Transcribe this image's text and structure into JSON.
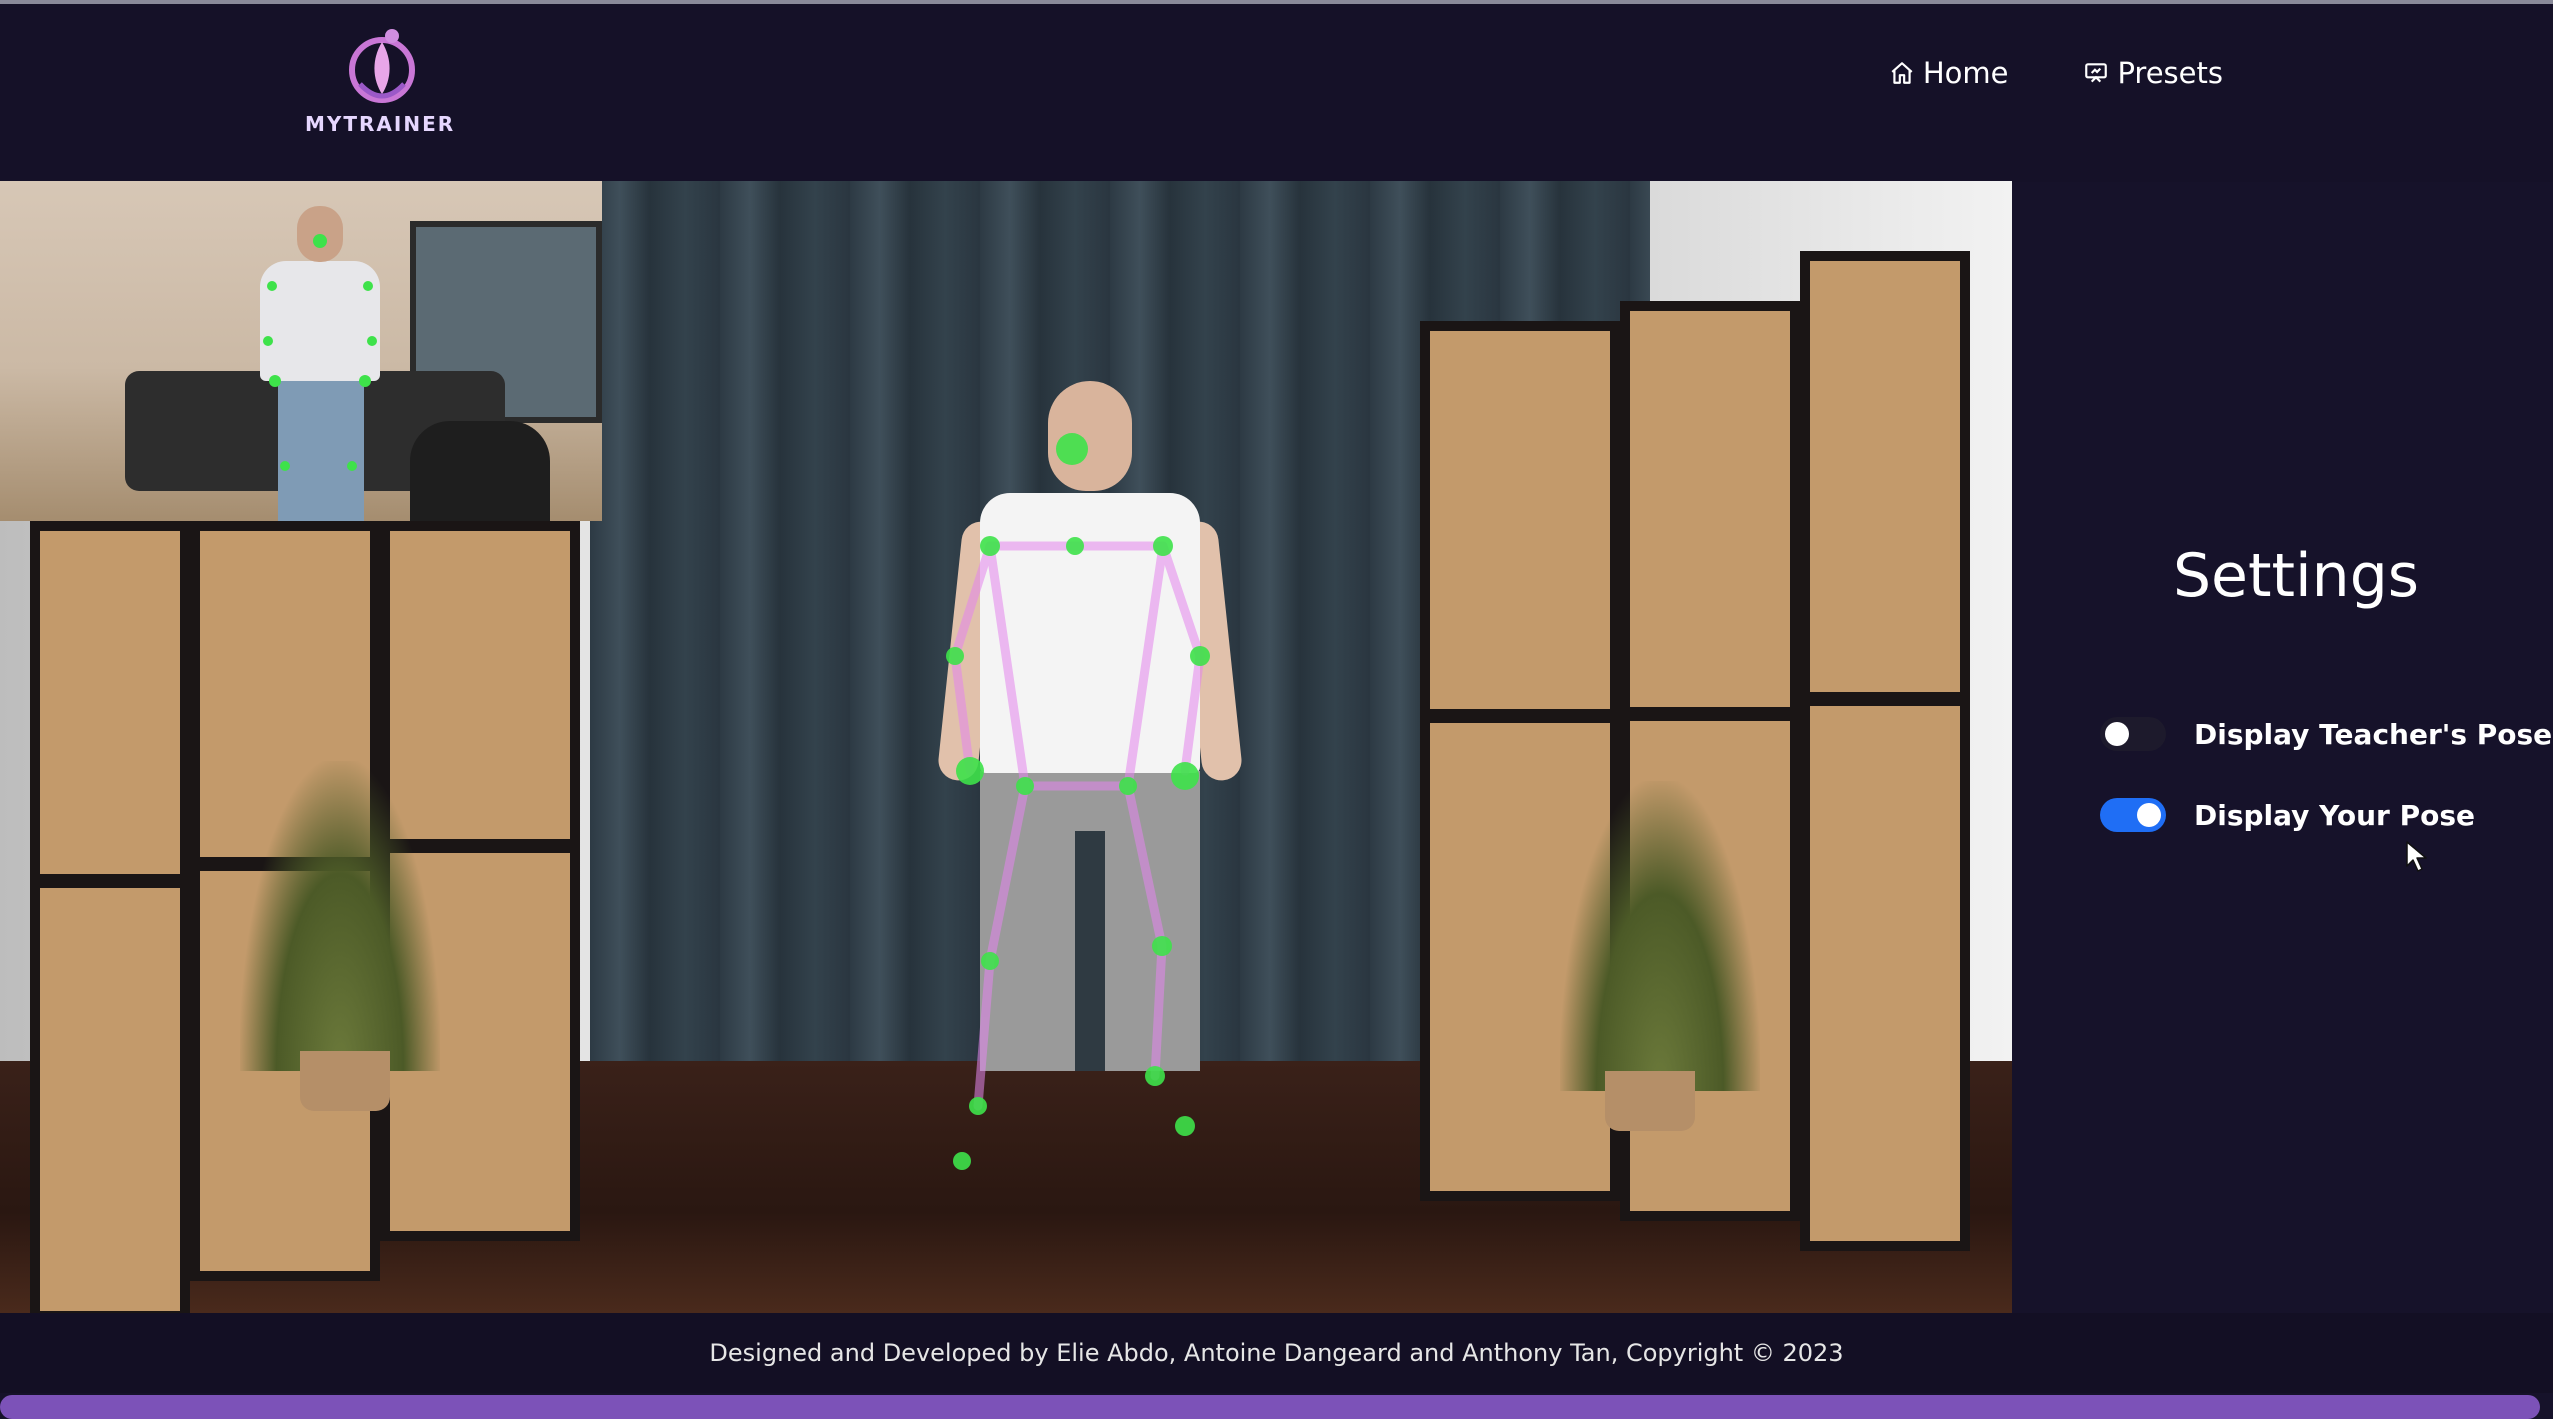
{
  "header": {
    "logo_text": "MYTRAINER",
    "nav": [
      {
        "label": "Home",
        "icon": "home-icon"
      },
      {
        "label": "Presets",
        "icon": "presets-icon"
      }
    ]
  },
  "settings": {
    "title": "Settings",
    "toggles": [
      {
        "label": "Display Teacher's Pose",
        "enabled": false
      },
      {
        "label": "Display Your Pose",
        "enabled": true
      }
    ]
  },
  "footer": {
    "credits": "Designed and Developed by Elie Abdo, Antoine Dangeard and Anthony Tan, Copyright © 2023"
  },
  "colors": {
    "background": "#16122a",
    "accent": "#7c52b8",
    "toggle_on": "#1f6ef5",
    "keypoint": "#3ee24a",
    "skeleton_line": "#e486ee"
  }
}
